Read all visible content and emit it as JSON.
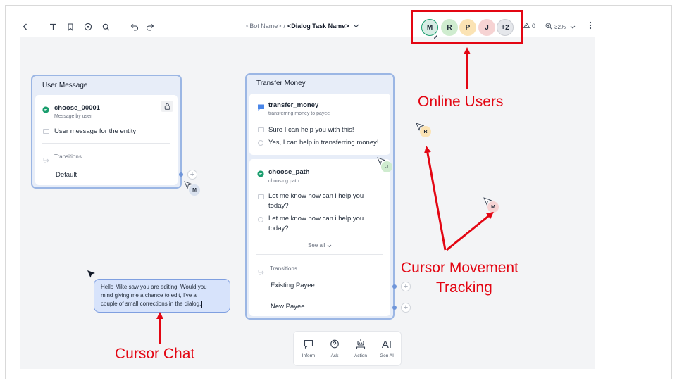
{
  "toolbar": {
    "back_icon": "chevron-left-icon",
    "icons": [
      "text-icon",
      "bookmark-icon",
      "comment-icon",
      "search-icon",
      "undo-icon",
      "redo-icon"
    ]
  },
  "breadcrumb": {
    "bot": "<Bot Name>",
    "separator": "/",
    "task": "<Dialog Task Name>"
  },
  "online_users": [
    {
      "initial": "M",
      "bg": "#d6ede4",
      "fg": "#1f2937",
      "ring": "#1a9e6e"
    },
    {
      "initial": "R",
      "bg": "#cfeccf",
      "fg": "#1f2937"
    },
    {
      "initial": "P",
      "bg": "#fbe3b4",
      "fg": "#1f2937"
    },
    {
      "initial": "J",
      "bg": "#f6d3d3",
      "fg": "#1f2937"
    },
    {
      "initial": "+2",
      "bg": "#e5e7eb",
      "fg": "#1f2937"
    }
  ],
  "warnings": {
    "count": "0"
  },
  "zoom": {
    "value": "32%"
  },
  "user_message_node": {
    "title": "User Message",
    "name": "choose_00001",
    "subtitle": "Message by user",
    "message": "User message for the entity",
    "transitions_label": "Transitions",
    "default_label": "Default"
  },
  "transfer_node": {
    "title": "Transfer Money",
    "card1": {
      "name": "transfer_money",
      "subtitle": "transferring money to payee",
      "line1": "Sure I can help you with this!",
      "line2": "Yes, I can help in transferring money!"
    },
    "card2": {
      "name": "choose_path",
      "subtitle": "choosing path",
      "line1a": "Let me know how can i help you",
      "line1b": "today?",
      "line2a": "Let me know how can i help you",
      "line2b": "today?",
      "see_all": "See all",
      "transitions_label": "Transitions",
      "option1": "Existing Payee",
      "option2": "New Payee"
    }
  },
  "cursors": [
    {
      "initial": "M",
      "bg": "#d9e1ee"
    },
    {
      "initial": "J",
      "bg": "#cfeccf"
    },
    {
      "initial": "R",
      "bg": "#fbe3b4"
    },
    {
      "initial": "M",
      "bg": "#f6d3d3"
    }
  ],
  "chat": {
    "line1": "Hello Mike saw you are editing. Would you",
    "line2": "mind giving me a chance to edit, I've a",
    "line3": "couple of small corrections in the dialog."
  },
  "dock": {
    "items": [
      {
        "label": "Inform",
        "icon": "message-square-icon"
      },
      {
        "label": "Ask",
        "icon": "question-bubble-icon"
      },
      {
        "label": "Action",
        "icon": "robot-icon"
      },
      {
        "label": "Gen AI",
        "icon": "ai-icon",
        "glyph": "AI"
      }
    ]
  },
  "annotations": {
    "online_users": "Online Users",
    "cursor_tracking_1": "Cursor Movement",
    "cursor_tracking_2": "Tracking",
    "cursor_chat": "Cursor Chat"
  },
  "colors": {
    "annotation_red": "#e30613",
    "node_border": "#9bb6e4",
    "node_bg": "#e7edf8",
    "accent_green": "#1a9e6e",
    "chat_bg": "#d7e3fb"
  }
}
